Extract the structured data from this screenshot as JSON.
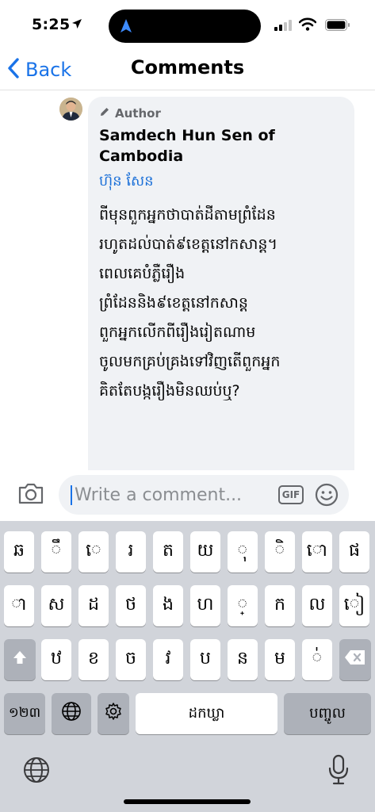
{
  "status_bar": {
    "time": "5:25"
  },
  "nav": {
    "back_label": "Back",
    "title": "Comments"
  },
  "comment": {
    "badge": "Author",
    "name": "Samdech Hun Sen of Cambodia",
    "subname": "ហ៊ុ​ន សែ​ន",
    "text_lines": [
      "ពីមុនពួកអ្នកថាបាត់ដីតាមព្រំដែន",
      "រហូតដល់បាត់៩ខេត្តនៅកសាន្ត។",
      "ពេលគេបំភ្លឺរឿង",
      "ព្រំដែននិង៩ខេត្តនៅកសាន្ត",
      "ពួកអ្នកលើកពីរឿងរៀតណាម",
      "ចូលមកគ្រប់គ្រងទៅវិញតើពួកអ្នក",
      "គិតតែបង្ករឿងមិនឈប់ឬ?"
    ]
  },
  "composer": {
    "placeholder": "Write a comment...",
    "gif_label": "GIF"
  },
  "keyboard": {
    "row1": [
      "ឆ",
      "ឹ",
      "េ",
      "រ",
      "ត",
      "យ",
      "ុ",
      "ិ",
      "ោ",
      "ផ"
    ],
    "row2": [
      "ា",
      "ស",
      "ដ",
      "ថ",
      "ង",
      "ហ",
      "្",
      "ក",
      "ល",
      "ៀ"
    ],
    "row3": [
      "ឋ",
      "ខ",
      "ច",
      "វ",
      "ប",
      "ន",
      "ម",
      "់"
    ],
    "numbers_key": "១២៣",
    "space_label": "ដកឃ្លា",
    "return_label": "បញ្ចូល"
  }
}
